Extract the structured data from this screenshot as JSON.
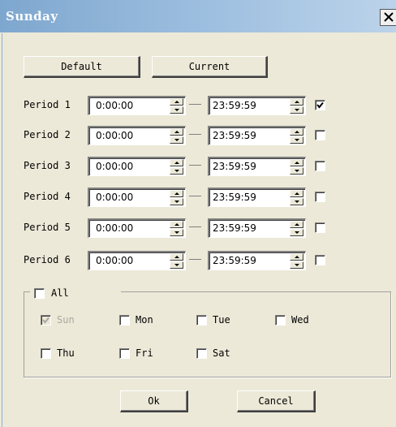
{
  "window": {
    "title": "Sunday"
  },
  "toolbar": {
    "default_label": "Default",
    "current_label": "Current"
  },
  "periods": [
    {
      "label": "Period 1",
      "start": "0:00:00",
      "end": "23:59:59",
      "enabled": true
    },
    {
      "label": "Period 2",
      "start": "0:00:00",
      "end": "23:59:59",
      "enabled": false
    },
    {
      "label": "Period 3",
      "start": "0:00:00",
      "end": "23:59:59",
      "enabled": false
    },
    {
      "label": "Period 4",
      "start": "0:00:00",
      "end": "23:59:59",
      "enabled": false
    },
    {
      "label": "Period 5",
      "start": "0:00:00",
      "end": "23:59:59",
      "enabled": false
    },
    {
      "label": "Period 6",
      "start": "0:00:00",
      "end": "23:59:59",
      "enabled": false
    }
  ],
  "days": {
    "all_label": "All",
    "all_checked": false,
    "items": [
      {
        "label": "Sun",
        "checked": true,
        "disabled": true
      },
      {
        "label": "Mon",
        "checked": false,
        "disabled": false
      },
      {
        "label": "Tue",
        "checked": false,
        "disabled": false
      },
      {
        "label": "Wed",
        "checked": false,
        "disabled": false
      },
      {
        "label": "Thu",
        "checked": false,
        "disabled": false
      },
      {
        "label": "Fri",
        "checked": false,
        "disabled": false
      },
      {
        "label": "Sat",
        "checked": false,
        "disabled": false
      }
    ]
  },
  "footer": {
    "ok_label": "Ok",
    "cancel_label": "Cancel"
  },
  "colors": {
    "title_bar": "#9fc0e0",
    "dialog_bg": "#ece9d8",
    "disabled_text": "#a8a8a0"
  }
}
